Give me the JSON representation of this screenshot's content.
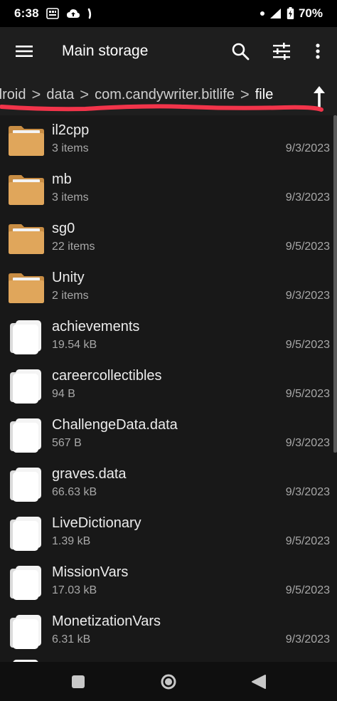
{
  "status_bar": {
    "time": "6:38",
    "battery_percent": "70%"
  },
  "app_bar": {
    "title": "Main storage"
  },
  "breadcrumb": {
    "items": [
      "droid",
      "data",
      "com.candywriter.bitlife",
      "file"
    ],
    "separator": ">"
  },
  "files": [
    {
      "name": "il2cpp",
      "meta": "3 items",
      "date": "9/3/2023",
      "kind": "folder"
    },
    {
      "name": "mb",
      "meta": "3 items",
      "date": "9/3/2023",
      "kind": "folder"
    },
    {
      "name": "sg0",
      "meta": "22 items",
      "date": "9/5/2023",
      "kind": "folder"
    },
    {
      "name": "Unity",
      "meta": "2 items",
      "date": "9/3/2023",
      "kind": "folder"
    },
    {
      "name": "achievements",
      "meta": "19.54 kB",
      "date": "9/5/2023",
      "kind": "file"
    },
    {
      "name": "careercollectibles",
      "meta": "94 B",
      "date": "9/5/2023",
      "kind": "file"
    },
    {
      "name": "ChallengeData.data",
      "meta": "567 B",
      "date": "9/3/2023",
      "kind": "file"
    },
    {
      "name": "graves.data",
      "meta": "66.63 kB",
      "date": "9/3/2023",
      "kind": "file"
    },
    {
      "name": "LiveDictionary",
      "meta": "1.39 kB",
      "date": "9/5/2023",
      "kind": "file"
    },
    {
      "name": "MissionVars",
      "meta": "17.03 kB",
      "date": "9/5/2023",
      "kind": "file"
    },
    {
      "name": "MonetizationVars",
      "meta": "6.31 kB",
      "date": "9/3/2023",
      "kind": "file"
    }
  ],
  "colors": {
    "folder": "#e0a65b",
    "folder_dark": "#c88d44",
    "file": "#f4f4f4",
    "underline": "#f2344a",
    "app_bar_bg": "#1e1e1e",
    "list_bg": "#181818"
  }
}
